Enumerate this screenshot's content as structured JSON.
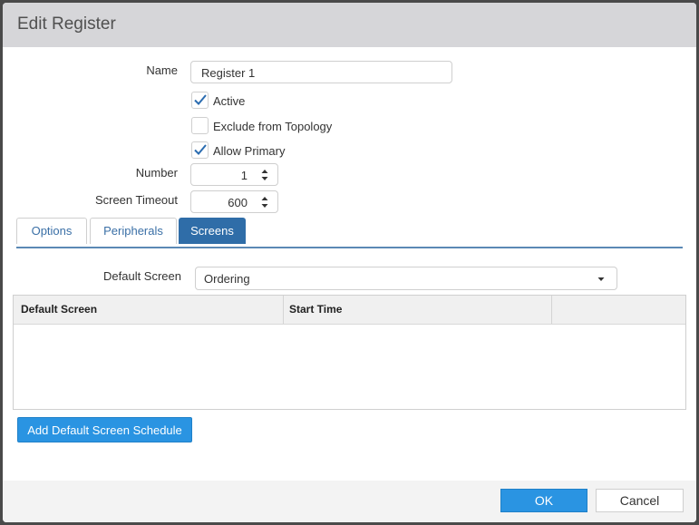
{
  "dialog": {
    "title": "Edit Register"
  },
  "form": {
    "name_label": "Name",
    "name_value": "Register 1",
    "active_label": "Active",
    "active_checked": true,
    "exclude_label": "Exclude from Topology",
    "exclude_checked": false,
    "allow_primary_label": "Allow Primary",
    "allow_primary_checked": true,
    "number_label": "Number",
    "number_value": "1",
    "timeout_label": "Screen Timeout",
    "timeout_value": "600"
  },
  "tabs": [
    {
      "label": "Options",
      "active": false
    },
    {
      "label": "Peripherals",
      "active": false
    },
    {
      "label": "Screens",
      "active": true
    }
  ],
  "screens": {
    "default_screen_label": "Default Screen",
    "default_screen_value": "Ordering",
    "table_headers": [
      "Default Screen",
      "Start Time",
      ""
    ],
    "rows": [],
    "add_button_label": "Add Default Screen Schedule"
  },
  "footer": {
    "ok_label": "OK",
    "cancel_label": "Cancel"
  },
  "colors": {
    "accent": "#2a94e2",
    "tab_active": "#2f6da8",
    "check": "#2b6cb0"
  },
  "icons": [
    "check-icon",
    "spin-up-icon",
    "spin-down-icon",
    "dropdown-arrow-icon"
  ]
}
